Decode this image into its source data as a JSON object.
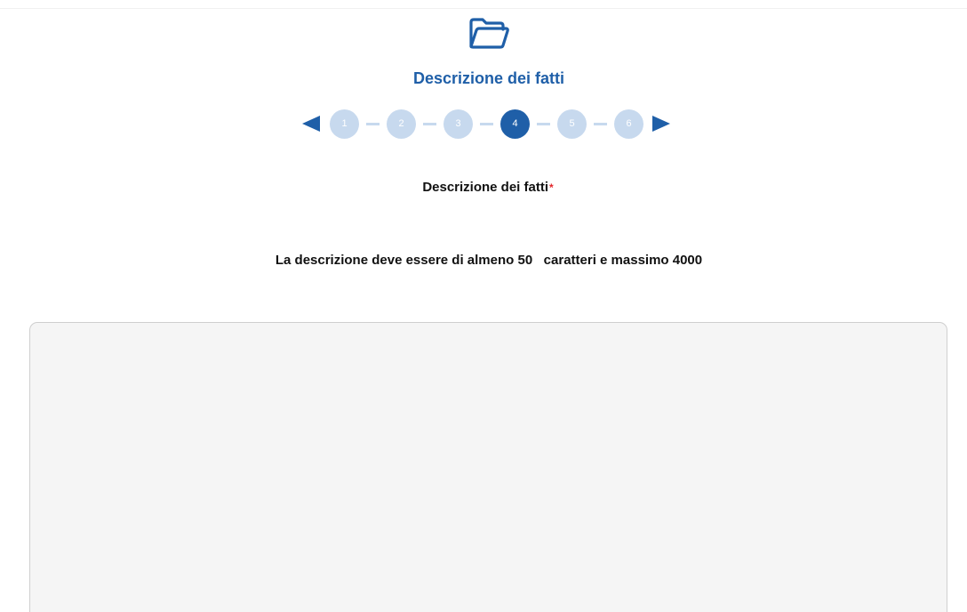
{
  "step": {
    "icon": "folder-open-icon",
    "title": "Descrizione dei fatti"
  },
  "stepper": {
    "prev_icon": "arrow-left-icon",
    "next_icon": "arrow-right-icon",
    "steps": [
      "1",
      "2",
      "3",
      "4",
      "5",
      "6"
    ],
    "current_step": "4"
  },
  "form": {
    "label": "Descrizione dei fatti",
    "required_mark": "*",
    "hint": "La descrizione deve essere di almeno 50   caratteri e massimo 4000",
    "textarea_value": ""
  },
  "colors": {
    "accent": "#1f5fa8",
    "inactive_step": "#c7d9ee",
    "required": "#e3262b",
    "field_background": "#f5f5f5"
  }
}
